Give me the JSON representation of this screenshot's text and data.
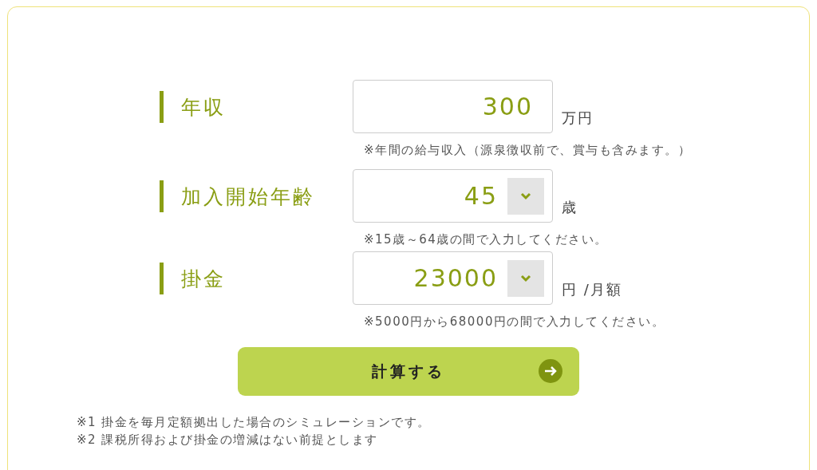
{
  "fields": [
    {
      "label": "年収",
      "kind": "text",
      "value": "300",
      "unit": "万円",
      "note": "※年間の給与収入（源泉徴収前で、賞与も含みます。）"
    },
    {
      "label": "加入開始年齢",
      "kind": "select",
      "value": "45",
      "unit": "歳",
      "note": "※15歳～64歳の間で入力してください。"
    },
    {
      "label": "掛金",
      "kind": "select",
      "value": "23000",
      "unit": "円 /月額",
      "note": "※5000円から68000円の間で入力してください。"
    }
  ],
  "submit_button": "計算する",
  "footnotes": [
    "※1 掛金を毎月定額拠出した場合のシミュレーションです。",
    "※2 課税所得および掛金の増減はない前提とします"
  ]
}
